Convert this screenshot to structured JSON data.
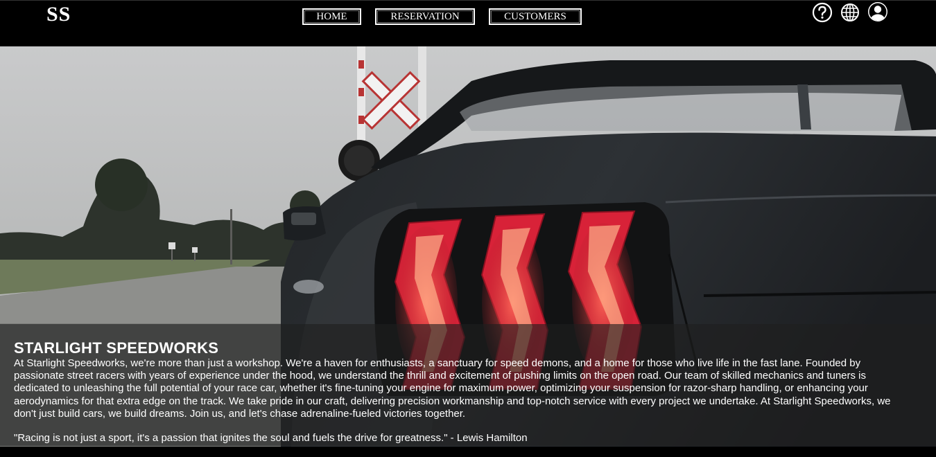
{
  "header": {
    "logo": "SS",
    "nav": [
      {
        "label": "HOME"
      },
      {
        "label": "RESERVATION"
      },
      {
        "label": "CUSTOMERS"
      }
    ],
    "icons": [
      "help-icon",
      "globe-icon",
      "user-account-icon"
    ]
  },
  "hero": {
    "image": "dark-sports-car-rear-taillights",
    "title": "STARLIGHT SPEEDWORKS",
    "description_lines": [
      "At Starlight Speedworks, we're more than just a workshop. We're a haven for enthusiasts, a sanctuary for speed demons, and a home for those who live life in the fast lane. Founded by",
      "passionate street racers with years of experience under the hood, we understand the thrill and excitement of pushing limits on the open road. Our team of skilled mechanics and tuners is",
      "dedicated to unleashing the full potential of your race car, whether it's fine-tuning your engine for maximum power, optimizing your suspension for razor-sharp handling, or enhancing your",
      "aerodynamics for that extra edge on the track. We take pride in our craft, delivering precision workmanship and top-notch service with every project we undertake. At Starlight Speedworks, we",
      "don't just build cars, we build dreams. Join us, and let's chase adrenaline-fueled victories together."
    ],
    "quote": "\"Racing is not just a sport, it's a passion that ignites the soul and fuels the drive for greatness.\" - Lewis Hamilton"
  },
  "colors": {
    "background": "#000000",
    "text": "#ffffff",
    "taillight": "#e0243c"
  }
}
